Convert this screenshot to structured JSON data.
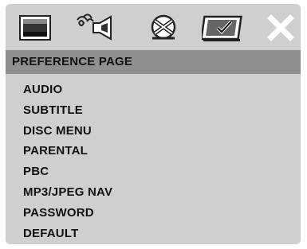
{
  "toolbar": {
    "icons": [
      "general-setup-icon",
      "audio-setup-icon",
      "video-setup-icon",
      "preference-page-icon",
      "exit-icon"
    ],
    "selected_index": 3
  },
  "header": {
    "title": "PREFERENCE PAGE"
  },
  "menu": {
    "items": [
      "AUDIO",
      "SUBTITLE",
      "DISC MENU",
      "PARENTAL",
      "PBC",
      "MP3/JPEG NAV",
      "PASSWORD",
      "DEFAULT"
    ]
  },
  "colors": {
    "panel": "#cfcfcf",
    "header_bar": "#8f8f8f",
    "text": "#111111"
  }
}
